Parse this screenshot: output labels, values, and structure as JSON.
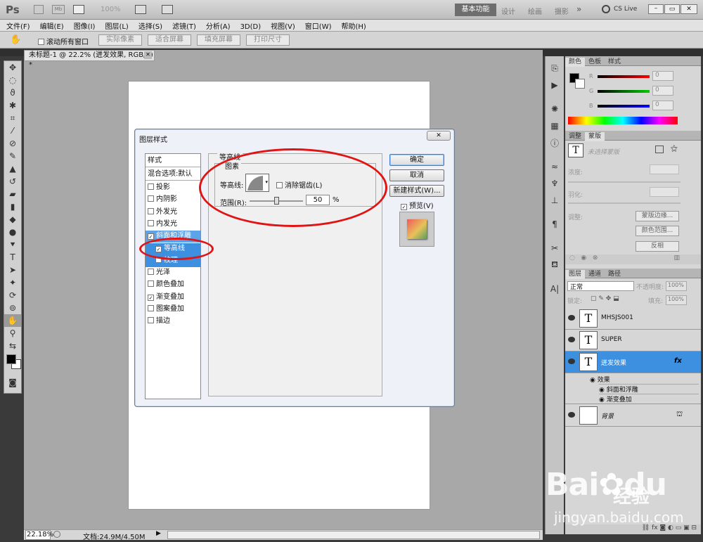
{
  "app": {
    "logo": "Ps",
    "zoom": "100%",
    "workspace_active": "基本功能",
    "workspaces": [
      "设计",
      "绘画",
      "摄影"
    ],
    "cslive": "CS Live"
  },
  "menu": [
    "文件(F)",
    "编辑(E)",
    "图像(I)",
    "图层(L)",
    "选择(S)",
    "滤镜(T)",
    "分析(A)",
    "3D(D)",
    "视图(V)",
    "窗口(W)",
    "帮助(H)"
  ],
  "options": {
    "scroll_all": "滚动所有窗口",
    "actual_pixels": "实际像素",
    "fit_screen": "适合屏幕",
    "fill_screen": "填充屏幕",
    "print_size": "打印尺寸"
  },
  "doc_tab": "未标题-1 @ 22.2% (迸发效果, RGB/8) *",
  "status": {
    "zoom": "22.18%",
    "doc": "文档:24.9M/4.50M"
  },
  "dialog": {
    "title": "图层样式",
    "style_header": "样式",
    "blend": "混合选项:默认",
    "styles": [
      {
        "label": "投影",
        "checked": false
      },
      {
        "label": "内阴影",
        "checked": false
      },
      {
        "label": "外发光",
        "checked": false
      },
      {
        "label": "内发光",
        "checked": false
      },
      {
        "label": "斜面和浮雕",
        "checked": true
      },
      {
        "label": "等高线",
        "checked": true
      },
      {
        "label": "纹理",
        "checked": false
      },
      {
        "label": "光泽",
        "checked": false
      },
      {
        "label": "颜色叠加",
        "checked": false
      },
      {
        "label": "渐变叠加",
        "checked": true
      },
      {
        "label": "图案叠加",
        "checked": false
      },
      {
        "label": "描边",
        "checked": false
      }
    ],
    "section": "等高线",
    "group": "图素",
    "contour_label": "等高线:",
    "antialias": "消除锯齿(L)",
    "range_label": "范围(R):",
    "range_value": "50",
    "range_unit": "%",
    "range_pct": 0.5,
    "ok": "确定",
    "cancel": "取消",
    "new_style": "新建样式(W)...",
    "preview": "预览(V)"
  },
  "panels": {
    "color_tabs": [
      "颜色",
      "色板",
      "样式"
    ],
    "rgb": [
      {
        "ch": "R",
        "val": "0"
      },
      {
        "ch": "G",
        "val": "0"
      },
      {
        "ch": "B",
        "val": "0"
      }
    ],
    "adj_tabs": [
      "调整",
      "蒙版"
    ],
    "mask_none": "未选择蒙版",
    "density": "浓度:",
    "feather": "羽化:",
    "refine": "调整:",
    "mask_edge": "蒙版边缘...",
    "color_range": "颜色范围...",
    "invert": "反相",
    "layer_tabs": [
      "图层",
      "通道",
      "路径"
    ],
    "blend_mode": "正常",
    "opacity_label": "不透明度:",
    "opacity": "100%",
    "lock_label": "锁定:",
    "fill_label": "填充:",
    "fill": "100%",
    "layers": [
      {
        "name": "MHSJS001",
        "type": "T"
      },
      {
        "name": "SUPER",
        "type": "T"
      },
      {
        "name": "迸发效果",
        "type": "T"
      }
    ],
    "effects_label": "效果",
    "effects": [
      "斜面和浮雕",
      "渐变叠加"
    ],
    "bg_layer": "背景"
  },
  "watermark": {
    "brand": "Bai",
    "brand2": "du",
    "cn": "经验",
    "url": "jingyan.baidu.com"
  },
  "colors": {
    "selection": "#3d8fe0",
    "annotation": "#e01414"
  }
}
